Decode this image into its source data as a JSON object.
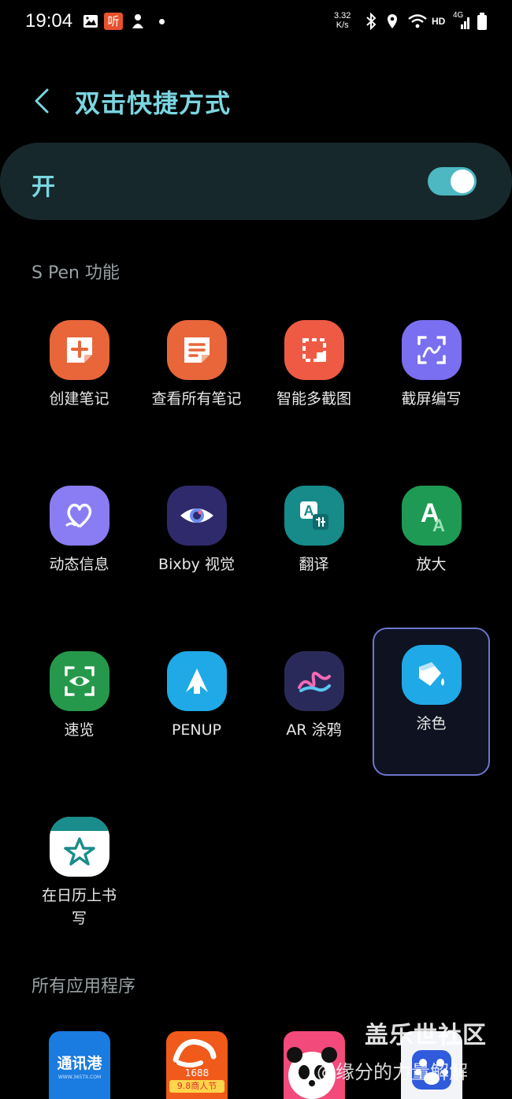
{
  "status_bar": {
    "time": "19:04",
    "net_speed_value": "3.32",
    "net_speed_unit": "K/s",
    "network_label": "HD",
    "cell_label": "4G",
    "icons": [
      "gallery-icon",
      "ting-app-icon",
      "game-icon",
      "dot-icon",
      "bluetooth-icon",
      "location-icon",
      "wifi-icon",
      "signal-icon",
      "battery-icon"
    ]
  },
  "header": {
    "title": "双击快捷方式"
  },
  "toggle": {
    "label": "开",
    "state": "on",
    "accent": "#4db7c2"
  },
  "sections": {
    "spen": "S Pen 功能",
    "all_apps": "所有应用程序"
  },
  "apps": [
    {
      "label": "创建笔记"
    },
    {
      "label": "查看所有笔记"
    },
    {
      "label": "智能多截图"
    },
    {
      "label": "截屏编写"
    },
    {
      "label": "动态信息"
    },
    {
      "label": "Bixby 视觉"
    },
    {
      "label": "翻译"
    },
    {
      "label": "放大"
    },
    {
      "label": "速览"
    },
    {
      "label": "PENUP"
    },
    {
      "label": "AR 涂鸦"
    },
    {
      "label": "涂色",
      "selected": true
    },
    {
      "label": "在日历上书写"
    }
  ],
  "bottom_apps": {
    "tongxungang": "通讯港",
    "tongxungang_url": "WWW.365TX.COM",
    "ali_number": "1688",
    "ali_event": "9.8商人节"
  },
  "watermark": {
    "line1": "盖乐世社区",
    "line2": "@缘分的力量解解"
  }
}
